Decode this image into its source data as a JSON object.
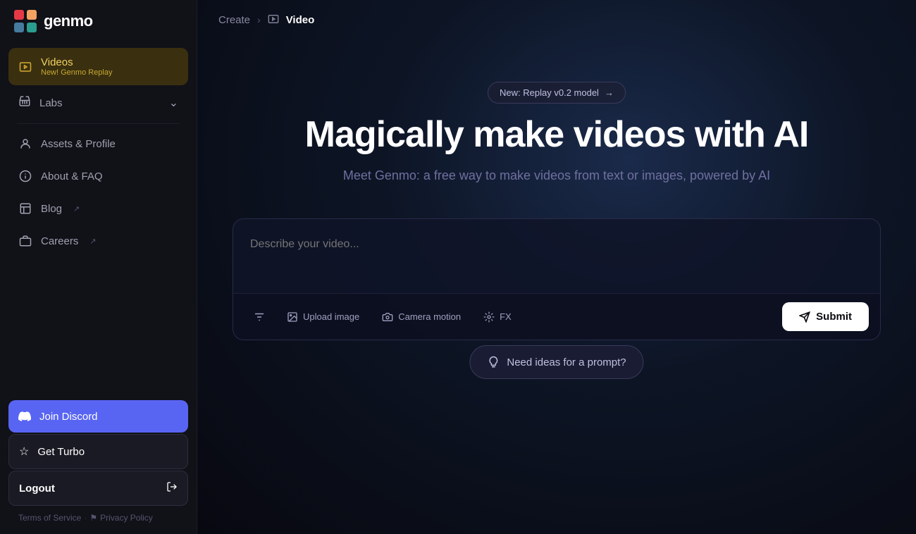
{
  "logo": {
    "text": "genmo"
  },
  "sidebar": {
    "videos": {
      "label": "Videos",
      "sublabel": "New! Genmo Replay"
    },
    "labs": {
      "label": "Labs"
    },
    "assets_profile": {
      "label": "Assets & Profile"
    },
    "about_faq": {
      "label": "About & FAQ"
    },
    "blog": {
      "label": "Blog"
    },
    "careers": {
      "label": "Careers"
    },
    "join_discord": {
      "label": "Join Discord"
    },
    "get_turbo": {
      "label": "Get Turbo"
    },
    "logout": {
      "label": "Logout"
    }
  },
  "footer": {
    "tos": "Terms of Service",
    "privacy": "Privacy Policy"
  },
  "breadcrumb": {
    "create": "Create",
    "separator": "›",
    "video": "Video"
  },
  "hero": {
    "badge": "New: Replay v0.2 model",
    "badge_arrow": "→",
    "title": "Magically make videos with AI",
    "subtitle": "Meet Genmo: a free way to make videos from text or images, powered by AI"
  },
  "prompt": {
    "placeholder": "Describe your video...",
    "upload_image": "Upload image",
    "camera_motion": "Camera motion",
    "fx": "FX",
    "submit": "Submit"
  },
  "ideas": {
    "label": "Need ideas for a prompt?"
  }
}
